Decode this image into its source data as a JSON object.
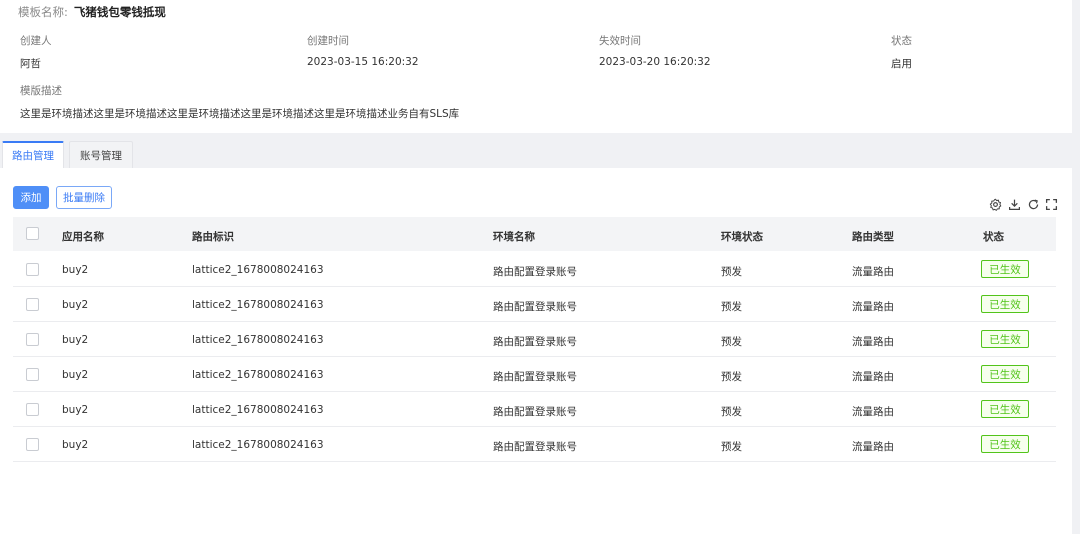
{
  "template": {
    "name_label": "模板名称:",
    "name_value": "飞猪钱包零钱抵现"
  },
  "info": {
    "creator_label": "创建人",
    "creator_value": "阿哲",
    "created_label": "创建时间",
    "created_value": "2023-03-15 16:20:32",
    "expire_label": "失效时间",
    "expire_value": "2023-03-20 16:20:32",
    "status_label": "状态",
    "status_value": "启用",
    "desc_label": "模版描述",
    "desc_value": "这里是环境描述这里是环境描述这里是环境描述这里是环境描述这里是环境描述业务自有SLS库"
  },
  "tabs": [
    {
      "label": "路由管理",
      "active": true
    },
    {
      "label": "账号管理",
      "active": false
    }
  ],
  "toolbar": {
    "add_label": "添加",
    "batch_delete_label": "批量删除",
    "icons": [
      "settings-icon",
      "download-icon",
      "refresh-icon",
      "fullscreen-icon"
    ]
  },
  "table": {
    "columns": [
      "应用名称",
      "路由标识",
      "环境名称",
      "环境状态",
      "路由类型",
      "状态"
    ],
    "rows": [
      {
        "app": "buy2",
        "route_id": "lattice2_1678008024163",
        "env_name": "路由配置登录账号",
        "env_status": "预发",
        "route_type": "流量路由",
        "status": "已生效"
      },
      {
        "app": "buy2",
        "route_id": "lattice2_1678008024163",
        "env_name": "路由配置登录账号",
        "env_status": "预发",
        "route_type": "流量路由",
        "status": "已生效"
      },
      {
        "app": "buy2",
        "route_id": "lattice2_1678008024163",
        "env_name": "路由配置登录账号",
        "env_status": "预发",
        "route_type": "流量路由",
        "status": "已生效"
      },
      {
        "app": "buy2",
        "route_id": "lattice2_1678008024163",
        "env_name": "路由配置登录账号",
        "env_status": "预发",
        "route_type": "流量路由",
        "status": "已生效"
      },
      {
        "app": "buy2",
        "route_id": "lattice2_1678008024163",
        "env_name": "路由配置登录账号",
        "env_status": "预发",
        "route_type": "流量路由",
        "status": "已生效"
      },
      {
        "app": "buy2",
        "route_id": "lattice2_1678008024163",
        "env_name": "路由配置登录账号",
        "env_status": "预发",
        "route_type": "流量路由",
        "status": "已生效"
      }
    ]
  },
  "colors": {
    "accent": "#3a7bf5",
    "success": "#52c41a"
  }
}
